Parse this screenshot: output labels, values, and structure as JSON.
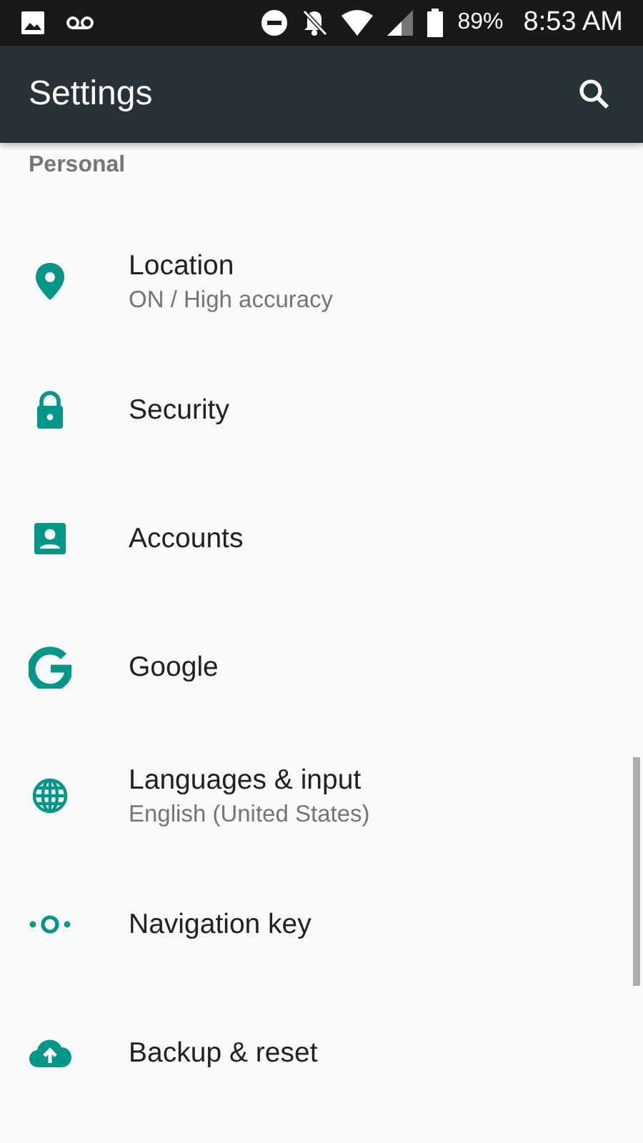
{
  "status_bar": {
    "battery": "89%",
    "time": "8:53 AM"
  },
  "app_bar": {
    "title": "Settings"
  },
  "section": {
    "title": "Personal"
  },
  "items": [
    {
      "title": "Location",
      "summary": "ON / High accuracy"
    },
    {
      "title": "Security"
    },
    {
      "title": "Accounts"
    },
    {
      "title": "Google"
    },
    {
      "title": "Languages & input",
      "summary": "English (United States)"
    },
    {
      "title": "Navigation key"
    },
    {
      "title": "Backup & reset"
    }
  ]
}
